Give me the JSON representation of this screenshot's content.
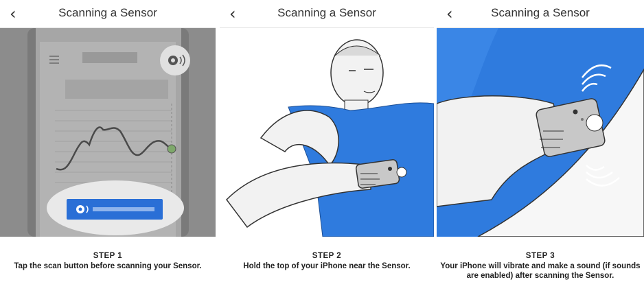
{
  "screens": [
    {
      "title": "Scanning a Sensor",
      "back_icon": "chevron-left-icon",
      "step": "STEP 1",
      "description": "Tap the scan button before scanning your Sensor."
    },
    {
      "title": "Scanning a Sensor",
      "back_icon": "chevron-left-icon",
      "step": "STEP 2",
      "description": "Hold the top of your iPhone near the Sensor."
    },
    {
      "title": "Scanning a Sensor",
      "back_icon": "chevron-left-icon",
      "step": "STEP 3",
      "description": "Your iPhone will vibrate and make a sound (if sounds are enabled) after scanning the Sensor."
    }
  ],
  "colors": {
    "accent_blue": "#2a6fd6",
    "shirt_blue": "#2f7bde",
    "gray_bg": "#8a8a8a",
    "sensor_green": "#7ea86b"
  }
}
